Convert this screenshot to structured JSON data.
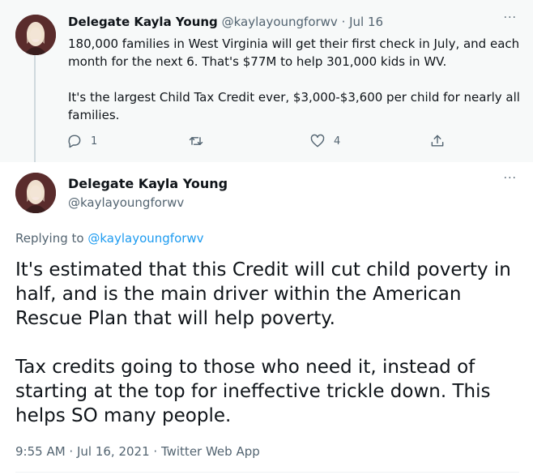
{
  "parent_tweet": {
    "author_name": "Delegate Kayla Young",
    "meta": "@kaylayoungforwv · Jul 16",
    "paragraphs": [
      "180,000 families in West Virginia will get their first check in July, and each month for the next 6. That's $77M to help 301,000  kids in WV.",
      "It's the largest Child Tax Credit ever, $3,000-$3,600 per child for nearly all families."
    ],
    "reply_count": "1",
    "retweet_count": "",
    "like_count": "4",
    "more_label": "···"
  },
  "main_tweet": {
    "author_name": "Delegate Kayla Young",
    "handle": "@kaylayoungforwv",
    "more_label": "···",
    "replying_prefix": "Replying to ",
    "replying_to": "@kaylayoungforwv",
    "paragraphs": [
      "It's estimated that this Credit will cut child poverty in half, and is the main driver within the American Rescue Plan that will help poverty.",
      "Tax credits going to those who need it, instead of starting at the top for ineffective trickle down. This helps SO many people."
    ],
    "timestamp": "9:55 AM · Jul 16, 2021 · ",
    "source": "Twitter Web App"
  },
  "icons": {
    "reply": "reply-icon",
    "retweet": "retweet-icon",
    "like": "heart-icon",
    "share": "share-icon",
    "more": "more-icon"
  },
  "colors": {
    "link": "#1d9bf0",
    "secondary_text": "#536471",
    "parent_background": "#f7f9f9"
  }
}
